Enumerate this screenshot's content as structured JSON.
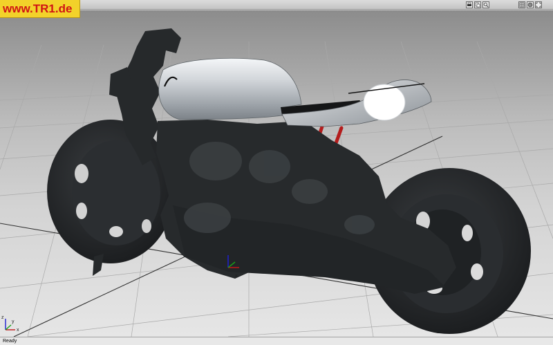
{
  "watermark": {
    "text": "www.TR1.de"
  },
  "toolbar": {
    "left_buttons": [
      "print-icon",
      "copy-icon",
      "zoom-icon"
    ],
    "right_buttons": [
      "grid-icon",
      "shade-icon",
      "fit-icon"
    ]
  },
  "axes_triad": {
    "x_label": "x",
    "y_label": "y",
    "z_label": "z"
  },
  "status": {
    "text": "Ready"
  },
  "colors": {
    "tank": "#c4c8cc",
    "frame_rails": "#b41c1c",
    "scan_mesh": "#26292b",
    "watermark_bg": "#f2d22a",
    "watermark_text": "#d01414"
  }
}
